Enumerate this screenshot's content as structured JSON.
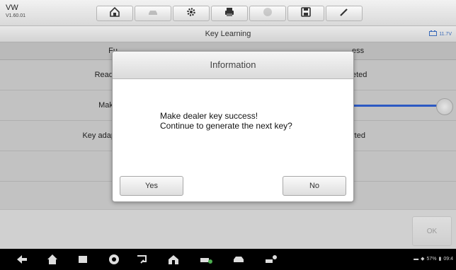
{
  "app": {
    "name": "VW",
    "version": "V1.60.01"
  },
  "toolbar": {
    "buttons": [
      {
        "name": "home",
        "icon": "home-icon",
        "enabled": true
      },
      {
        "name": "vehicle-swap",
        "icon": "vehicle-swap-icon",
        "enabled": false
      },
      {
        "name": "settings",
        "icon": "gear-icon",
        "enabled": true
      },
      {
        "name": "print",
        "icon": "printer-icon",
        "enabled": true
      },
      {
        "name": "help",
        "icon": "help-icon",
        "enabled": false
      },
      {
        "name": "save",
        "icon": "save-icon",
        "enabled": true
      },
      {
        "name": "data-logging",
        "icon": "pen-icon",
        "enabled": true
      }
    ]
  },
  "title_bar": {
    "title": "Key Learning",
    "battery_reading": "11.7V"
  },
  "table": {
    "header": {
      "function": "Fu",
      "status": "ess"
    },
    "rows": [
      {
        "function": "Read I",
        "status": "eted"
      },
      {
        "function": "Make ",
        "status": ""
      },
      {
        "function": "Key adapt",
        "status": "rted"
      }
    ],
    "progress_fraction": 1.0
  },
  "ok_button": {
    "label": "OK",
    "enabled": false
  },
  "dialog": {
    "title": "Information",
    "message_line1": "Make dealer key success!",
    "message_line2": "Continue to generate the next key?",
    "yes_label": "Yes",
    "no_label": "No"
  },
  "android_nav": {
    "icons": [
      "back-icon",
      "home-icon",
      "recents-icon",
      "chrome-icon",
      "screen-cast-icon",
      "maxisys-home-icon",
      "vehicle-service-icon",
      "car-icon",
      "shop-icon"
    ],
    "status": {
      "battery": "57%",
      "time": "09:4"
    }
  },
  "colors": {
    "accent": "#2f5fd0",
    "nav_bg": "#000000"
  }
}
